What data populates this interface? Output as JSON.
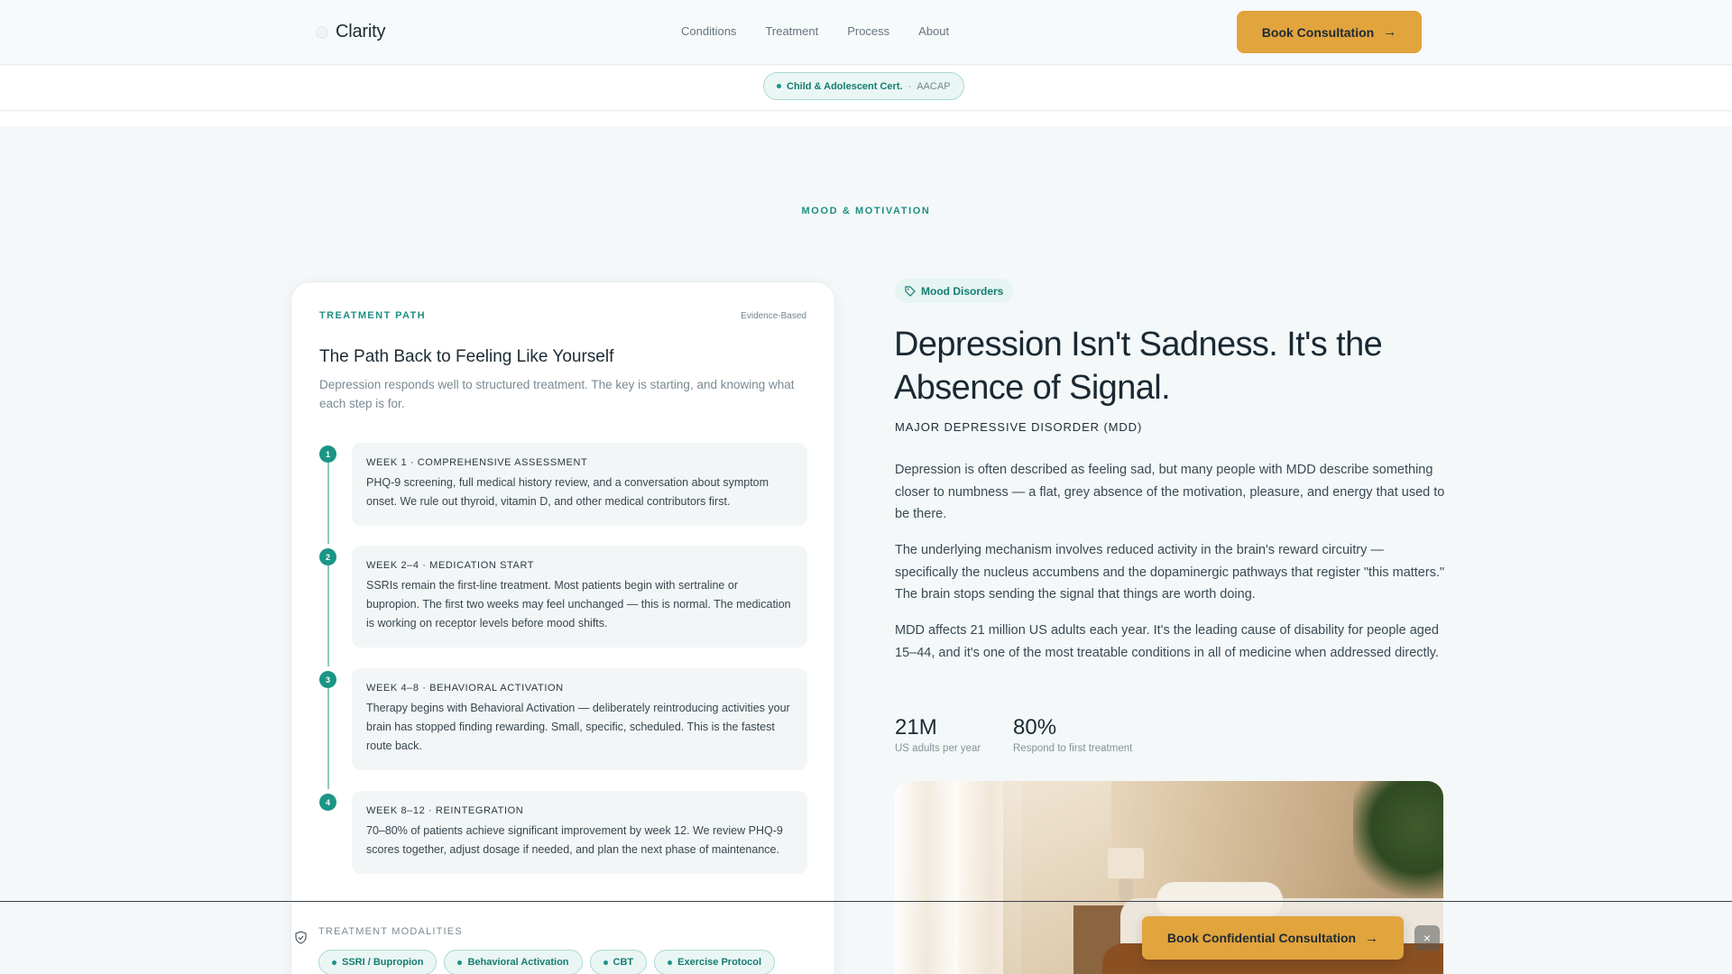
{
  "header": {
    "brand": "Clarity",
    "nav": [
      "Conditions",
      "Treatment",
      "Process",
      "About"
    ],
    "cta_label": "Book Consultation"
  },
  "cert": {
    "label": "Child & Adolescent Cert.",
    "separator": "·",
    "source": "AACAP"
  },
  "section": {
    "eyebrow": "MOOD & MOTIVATION"
  },
  "treatment": {
    "label": "TREATMENT PATH",
    "badge": "Evidence-Based",
    "title": "The Path Back to Feeling Like Yourself",
    "description": "Depression responds well to structured treatment. The key is starting, and knowing what each step is for.",
    "steps": [
      {
        "num": "1",
        "heading": "WEEK 1 · COMPREHENSIVE ASSESSMENT",
        "body": "PHQ-9 screening, full medical history review, and a conversation about symptom onset. We rule out thyroid, vitamin D, and other medical contributors first."
      },
      {
        "num": "2",
        "heading": "WEEK 2–4 · MEDICATION START",
        "body": "SSRIs remain the first-line treatment. Most patients begin with sertraline or bupropion. The first two weeks may feel unchanged — this is normal. The medication is working on receptor levels before mood shifts."
      },
      {
        "num": "3",
        "heading": "WEEK 4–8 · BEHAVIORAL ACTIVATION",
        "body": "Therapy begins with Behavioral Activation — deliberately reintroducing activities your brain has stopped finding rewarding. Small, specific, scheduled. This is the fastest route back."
      },
      {
        "num": "4",
        "heading": "WEEK 8–12 · REINTEGRATION",
        "body": "70–80% of patients achieve significant improvement by week 12. We review PHQ-9 scores together, adjust dosage if needed, and plan the next phase of maintenance."
      }
    ],
    "modalities_label": "TREATMENT MODALITIES",
    "modalities": [
      "SSRI / Bupropion",
      "Behavioral Activation",
      "CBT",
      "Exercise Protocol"
    ]
  },
  "condition": {
    "tag": "Mood Disorders",
    "headline": "Depression Isn't Sadness. It's the Absence of Signal.",
    "subhead": "MAJOR DEPRESSIVE DISORDER (MDD)",
    "paragraphs": [
      "Depression is often described as feeling sad, but many people with MDD describe something closer to numbness — a flat, grey absence of the motivation, pleasure, and energy that used to be there.",
      "The underlying mechanism involves reduced activity in the brain's reward circuitry — specifically the nucleus accumbens and the dopaminergic pathways that register \"this matters.\" The brain stops sending the signal that things are worth doing.",
      "MDD affects 21 million US adults each year. It's the leading cause of disability for people aged 15–44, and it's one of the most treatable conditions in all of medicine when addressed directly."
    ],
    "stats": [
      {
        "value": "21M",
        "label": "US adults per year"
      },
      {
        "value": "80%",
        "label": "Respond to first treatment"
      }
    ]
  },
  "sticky": {
    "cta_label": "Book Confidential Consultation",
    "close_glyph": "×"
  },
  "icons": {
    "arrow": "arrow-right-icon",
    "tag": "tag-icon",
    "shield": "shield-check-icon",
    "close": "close-icon"
  },
  "colors": {
    "accent": "#1f8f84",
    "cta": "#e2a43d",
    "background": "#f4f8f9"
  }
}
